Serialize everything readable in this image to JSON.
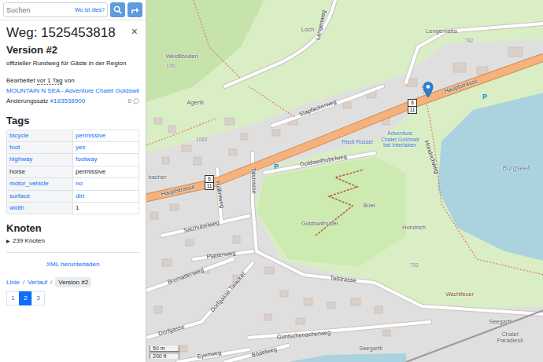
{
  "search": {
    "placeholder": "Suchen",
    "where_link": "Wo ist dies?"
  },
  "feature": {
    "title": "Weg: 1525453818",
    "close": "×",
    "version": "Version #2",
    "description": "offizieller Rundweg für Gäste in der Region",
    "edited": {
      "prefix": "Bearbeitet",
      "time": "vor 1 Tag",
      "by": "von",
      "user": "MOUNTAIN N SEA - Adventure Chalet Goldswil",
      "changeset_label": "Änderungssatz",
      "changeset": "#183538900",
      "comments": "0"
    },
    "tags_heading": "Tags",
    "tags": [
      {
        "key": "bicycle",
        "value": "permissive",
        "key_link": true,
        "value_link": true
      },
      {
        "key": "foot",
        "value": "yes",
        "key_link": true,
        "value_link": true
      },
      {
        "key": "highway",
        "value": "footway",
        "key_link": true,
        "value_link": true
      },
      {
        "key": "horse",
        "value": "permissive",
        "key_link": false,
        "value_link": false
      },
      {
        "key": "motor_vehicle",
        "value": "no",
        "key_link": true,
        "value_link": true
      },
      {
        "key": "surface",
        "value": "dirt",
        "key_link": true,
        "value_link": true
      },
      {
        "key": "width",
        "value": "1",
        "key_link": true,
        "value_link": false
      }
    ],
    "nodes": {
      "heading": "Knoten",
      "toggle": "▶",
      "label": "239 Knoten",
      "expanded": false
    },
    "download": "XML herunterladen",
    "nav": {
      "links": [
        "Linie",
        "Verlauf"
      ],
      "separator": "/",
      "current": "Version #2"
    },
    "pages": [
      {
        "label": "1",
        "selected": false
      },
      {
        "label": "2",
        "selected": true
      },
      {
        "label": "3",
        "selected": false
      }
    ]
  },
  "map": {
    "labels": [
      {
        "text": "Lengenweg",
        "kind": "street"
      },
      {
        "text": "Loch",
        "kind": "place"
      },
      {
        "text": "Lengematta",
        "kind": "place"
      },
      {
        "text": "782",
        "kind": "elevation"
      },
      {
        "text": "Weidliboden",
        "kind": "place"
      },
      {
        "text": "1067",
        "kind": "elevation"
      },
      {
        "text": "Agertli",
        "kind": "place"
      },
      {
        "text": "1063",
        "kind": "elevation"
      },
      {
        "text": "bacher",
        "kind": "place"
      },
      {
        "text": "Stapfackerweg",
        "kind": "street"
      },
      {
        "text": "Hauptstrasse",
        "kind": "street"
      },
      {
        "text": "Hauptstrasse",
        "kind": "street"
      },
      {
        "text": "Goldswilhubelweg",
        "kind": "street"
      },
      {
        "text": "Rallimweg",
        "kind": "street"
      },
      {
        "text": "Talstrasse",
        "kind": "street"
      },
      {
        "text": "Salzhubelweg",
        "kind": "street"
      },
      {
        "text": "Plattenweg",
        "kind": "street"
      },
      {
        "text": "Bromattenweg",
        "kind": "street"
      },
      {
        "text": "Dorfgasse Talacker",
        "kind": "street"
      },
      {
        "text": "Dorfgasse",
        "kind": "street"
      },
      {
        "text": "Talstrasse",
        "kind": "street"
      },
      {
        "text": "Güntschenacherweg",
        "kind": "street"
      },
      {
        "text": "Bödelweg",
        "kind": "street"
      },
      {
        "text": "Eyenweg",
        "kind": "street"
      },
      {
        "text": "Seegartli",
        "kind": "place"
      },
      {
        "text": "Seegartli",
        "kind": "place"
      },
      {
        "text": "Chalet Paradiesli",
        "kind": "place"
      },
      {
        "text": "Wachtfeuer",
        "kind": "landmark"
      },
      {
        "text": "Hondrich",
        "kind": "place"
      },
      {
        "text": "Büel",
        "kind": "place"
      },
      {
        "text": "Goldswilhubel",
        "kind": "place"
      },
      {
        "text": "Hondrichweg",
        "kind": "street"
      },
      {
        "text": "Burgseeli",
        "kind": "water"
      },
      {
        "text": "Riedi Russel",
        "kind": "poi"
      },
      {
        "text": "Adventure Chalet Goldswil bei Interlaken",
        "kind": "poi"
      },
      {
        "text": "793",
        "kind": "elevation"
      },
      {
        "text": "P",
        "kind": "parking"
      },
      {
        "text": "P",
        "kind": "parking"
      }
    ],
    "shields": [
      {
        "top": "6",
        "bottom": "11"
      },
      {
        "top": "6",
        "bottom": "11"
      }
    ],
    "scale": {
      "metric": "50 m",
      "imperial": "200 ft"
    }
  }
}
